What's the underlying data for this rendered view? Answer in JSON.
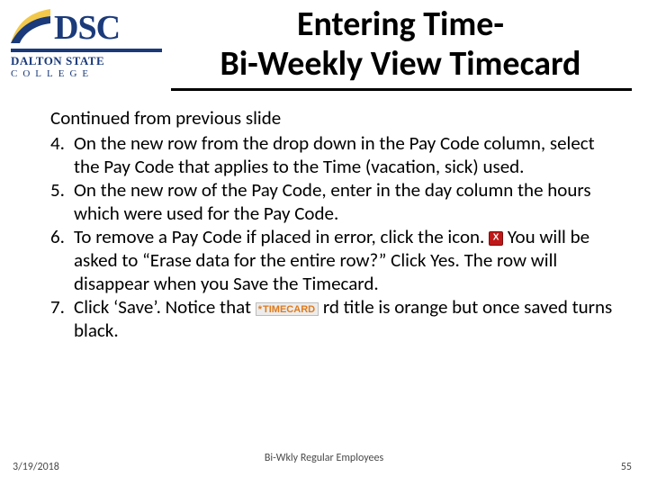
{
  "logo": {
    "letters": "DSC",
    "line1": "DALTON STATE",
    "line2": "COLLEGE"
  },
  "title": {
    "line1": "Entering Time-",
    "line2": "Bi-Weekly View Timecard"
  },
  "intro": "Continued from previous slide",
  "steps": [
    {
      "n": "4.",
      "text": "On the new row from the drop down in the Pay Code column, select the Pay Code that applies to the Time (vacation, sick) used."
    },
    {
      "n": "5.",
      "text": "On the new row of the Pay Code, enter in the day column the hours which were used for the Pay Code."
    },
    {
      "n": "6.",
      "pre": "To remove a Pay Code if placed in error, click the  icon. ",
      "post": " You will be asked to “Erase data for the entire row?” Click Yes.  The row will disappear when you Save the Timecard."
    },
    {
      "n": "7.",
      "pre": "Click ‘Save’.  Notice that  ",
      "mid_label": "TIMECARD",
      "post": "   rd title is orange but once saved turns black."
    }
  ],
  "footer": {
    "date": "3/19/2018",
    "center": "Bi-Wkly Regular Employees",
    "page": "55"
  }
}
